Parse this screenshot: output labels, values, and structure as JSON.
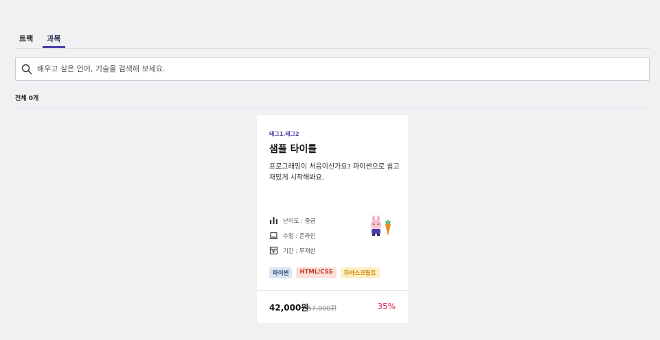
{
  "tabs": [
    {
      "label": "트랙",
      "active": false
    },
    {
      "label": "과목",
      "active": true
    }
  ],
  "search": {
    "placeholder": "배우고 싶은 언어, 기술을 검색해 보세요.",
    "value": ""
  },
  "results": {
    "count_label": "전체 0개"
  },
  "course_card": {
    "tags": "태그1,태그2",
    "title": "샘플 타이틀",
    "description": "프로그래밍이 처음이신가요? 파이썬으로 쉽고 재밌게 시작해봐요.",
    "meta": {
      "difficulty": "난이도 : 중급",
      "class_type": "수업 : 온라인",
      "duration": "기간 : 무제한"
    },
    "chips": [
      "파이썬",
      "HTML/CSS",
      "자바스크립트"
    ],
    "price": "42,000원",
    "original_price": "57,000원",
    "discount": "35%",
    "icons": [
      "bar-chart-icon",
      "laptop-icon",
      "calendar-icon",
      "rabbit-carrot-mascot"
    ]
  },
  "colors": {
    "accent": "#4a3fa8",
    "discount": "#e0284a",
    "background": "#f0f1f3"
  }
}
